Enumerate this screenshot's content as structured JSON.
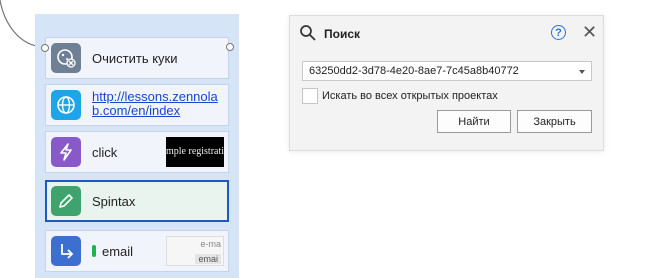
{
  "actions": [
    {
      "label": "Очистить куки",
      "icon": "cookie-clear-icon",
      "icon_color": "#6f7f94"
    },
    {
      "label": "http://lessons.zennolab.com/en/index",
      "icon": "globe-icon",
      "icon_color": "#1ea4e9"
    },
    {
      "label": "click",
      "icon": "lightning-icon",
      "icon_color": "#8a59c8",
      "thumb_text": "mple registrati"
    },
    {
      "label": "Spintax",
      "icon": "pencil-icon",
      "icon_color": "#3fa36d",
      "selected": true
    },
    {
      "label": "email",
      "icon": "arrow-turn-icon",
      "icon_color": "#3d6fd1",
      "thumb_text_top": "e-ma",
      "thumb_text_bottom": "emai"
    }
  ],
  "search_dialog": {
    "title": "Поиск",
    "help_glyph": "?",
    "close_glyph": "✕",
    "query_value": "63250dd2-3d78-4e20-8ae7-7c45a8b40772",
    "search_all_label": "Искать во всех открытых проектах",
    "search_all_checked": false,
    "find_button": "Найти",
    "close_button": "Закрыть"
  },
  "colors": {
    "block_bg": "#d6e4f7",
    "selection_border": "#1f58c2",
    "link_text": "#1a46c8",
    "dialog_bg": "#f3f3f3"
  }
}
